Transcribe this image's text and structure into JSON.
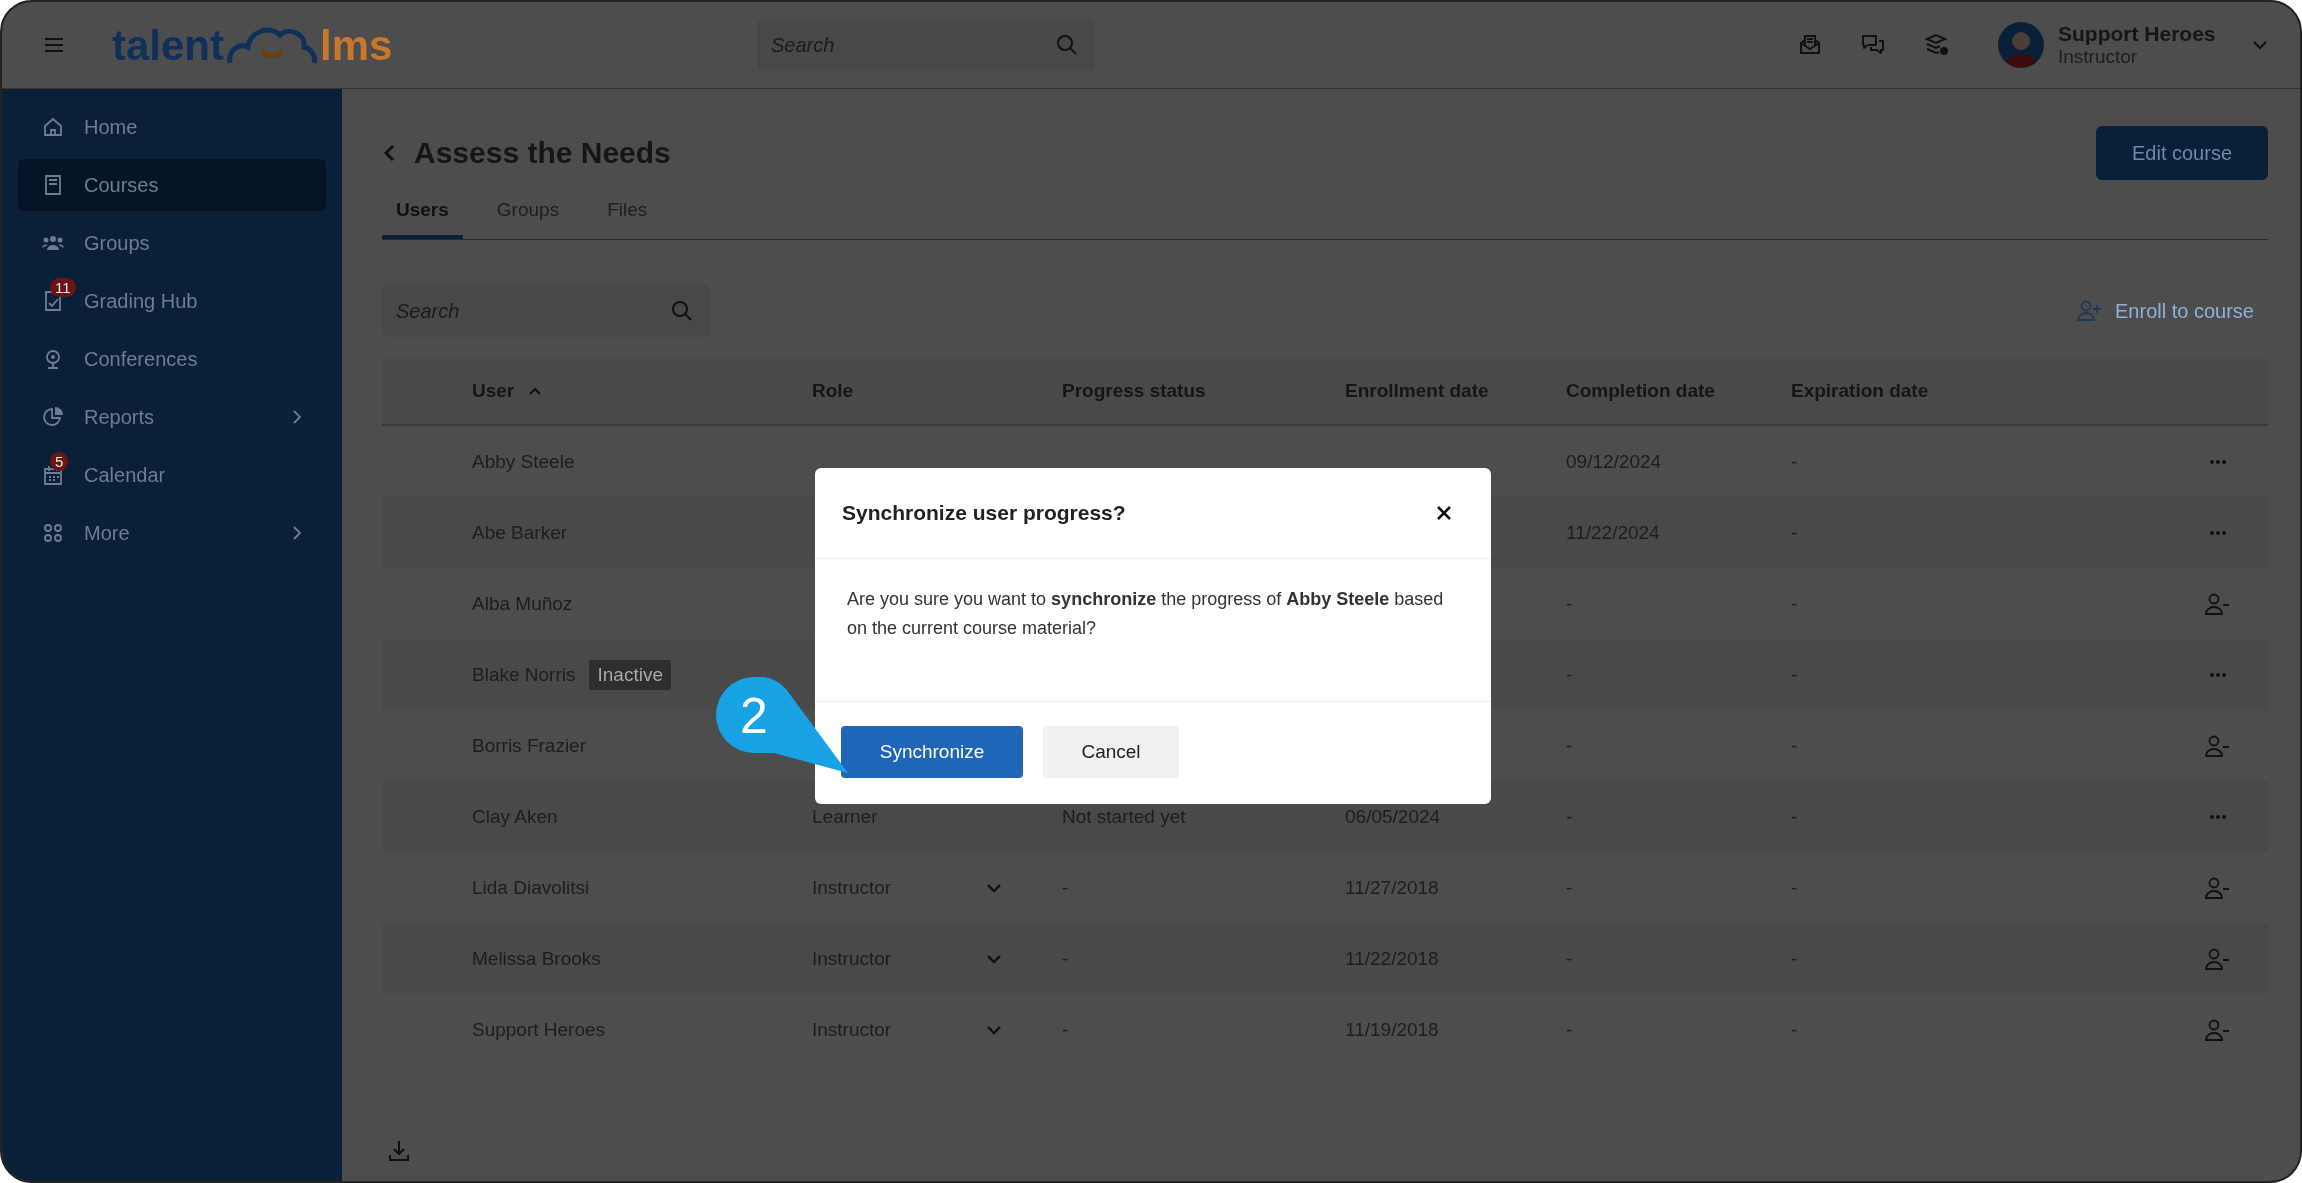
{
  "header": {
    "logo": {
      "left": "talent",
      "right": "lms"
    },
    "search": {
      "placeholder": "Search"
    },
    "user": {
      "name": "Support Heroes",
      "role": "Instructor"
    }
  },
  "sidebar": {
    "items": [
      {
        "label": "Home",
        "selected": false
      },
      {
        "label": "Courses",
        "selected": true
      },
      {
        "label": "Groups",
        "selected": false
      },
      {
        "label": "Grading Hub",
        "selected": false,
        "badge": "11"
      },
      {
        "label": "Conferences",
        "selected": false
      },
      {
        "label": "Reports",
        "selected": false,
        "submenu": true
      },
      {
        "label": "Calendar",
        "selected": false,
        "badge": "5"
      },
      {
        "label": "More",
        "selected": false,
        "submenu": true
      }
    ]
  },
  "page": {
    "title": "Assess the Needs",
    "edit_button": "Edit course",
    "tabs": [
      {
        "label": "Users",
        "selected": true
      },
      {
        "label": "Groups",
        "selected": false
      },
      {
        "label": "Files",
        "selected": false
      }
    ],
    "search": {
      "placeholder": "Search"
    },
    "enroll_link": "Enroll to course"
  },
  "table": {
    "columns": [
      "User",
      "Role",
      "Progress status",
      "Enrollment date",
      "Completion date",
      "Expiration date"
    ],
    "rows": [
      {
        "name": "Abby Steele",
        "completion_date": "09/12/2024",
        "expiration_date": "-",
        "kind": "more"
      },
      {
        "name": "Abe Barker",
        "completion_date": "11/22/2024",
        "expiration_date": "-",
        "kind": "more"
      },
      {
        "name": "Alba Muñoz",
        "completion_date": "-",
        "expiration_date": "-",
        "kind": "unenroll"
      },
      {
        "name": "Blake Norris",
        "tag": "Inactive",
        "completion_date": "-",
        "expiration_date": "-",
        "kind": "more"
      },
      {
        "name": "Borris Frazier",
        "completion_date": "-",
        "expiration_date": "-",
        "kind": "unenroll"
      },
      {
        "name": "Clay Aken",
        "role": "Learner",
        "progress": "Not started yet",
        "enrollment_date": "06/05/2024",
        "completion_date": "-",
        "expiration_date": "-",
        "kind": "more"
      },
      {
        "name": "Lida Diavolitsi",
        "role": "Instructor",
        "role_dropdown": true,
        "progress": "-",
        "enrollment_date": "11/27/2018",
        "completion_date": "-",
        "expiration_date": "-",
        "kind": "unenroll"
      },
      {
        "name": "Melissa Brooks",
        "role": "Instructor",
        "role_dropdown": true,
        "progress": "-",
        "enrollment_date": "11/22/2018",
        "completion_date": "-",
        "expiration_date": "-",
        "kind": "unenroll"
      },
      {
        "name": "Support Heroes",
        "role": "Instructor",
        "role_dropdown": true,
        "progress": "-",
        "enrollment_date": "11/19/2018",
        "completion_date": "-",
        "expiration_date": "-",
        "kind": "unenroll"
      }
    ]
  },
  "dialog": {
    "title": "Synchronize user progress?",
    "message": "Are you sure you want to **synchronize** the progress of **Abby Steele** based on the current course material?",
    "confirm": "Synchronize",
    "cancel": "Cancel"
  },
  "step_badge": "2"
}
